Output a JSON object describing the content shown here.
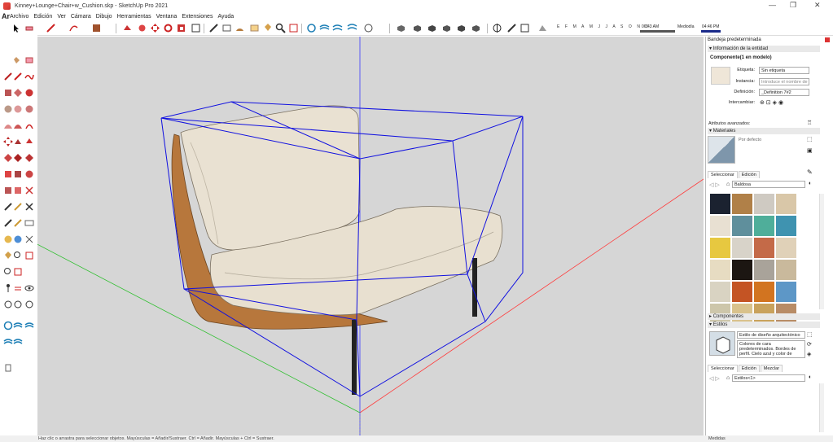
{
  "window": {
    "title": "Kinney+Lounge+Chair+w_Cushion.skp - SketchUp Pro 2021",
    "minimize_glyph": "—",
    "maximize_glyph": "❐",
    "close_glyph": "✕"
  },
  "menubar": {
    "prefix": "Ar",
    "items": [
      "Archivo",
      "Edición",
      "Ver",
      "Cámara",
      "Dibujo",
      "Herramientas",
      "Ventana",
      "Extensiones",
      "Ayuda"
    ]
  },
  "sun": {
    "months": "E F M A M J J A S O N D",
    "time_start": "06:43 AM",
    "label": "Mediodía",
    "time_end": "04:46 PM"
  },
  "tray": {
    "title": "Bandeja predeterminada",
    "entity_info": {
      "header": "Información de la entidad",
      "kind": "Componente(1 en modelo)",
      "tag_label": "Etiqueta:",
      "tag_value": "Sin etiqueta",
      "instance_label": "Instancia:",
      "instance_placeholder": "Introduce el nombre de",
      "definition_label": "Definición:",
      "definition_value": "_Definition 7#2",
      "toggles_label": "Intercambiar:",
      "advanced_label": "Atributos avanzados:"
    },
    "materials": {
      "header": "Materiales",
      "default_name": "Por defecto",
      "tabs": [
        "Seleccionar",
        "Edición"
      ],
      "library": "Baldosa",
      "swatches": [
        "#1b2230",
        "#b08048",
        "#cfcac2",
        "#d9c7a8",
        "#e8e0d2",
        "#5f8f9c",
        "#4fae9a",
        "#3f93b0",
        "#e7c840",
        "#d8d3c9",
        "#c46a48",
        "#e0d1b8",
        "#e7dcc2",
        "#1c1612",
        "#a9a39a",
        "#c9b99c",
        "#d9d3c2",
        "#c45424",
        "#d27420",
        "#5d97c7",
        "#cdc6aa",
        "#d9c28c",
        "#c9a25c",
        "#b88c66"
      ]
    },
    "components": {
      "header": "Componentes"
    },
    "styles": {
      "header": "Estilos",
      "style_name": "Estilo de diseño arquitectónico",
      "style_desc": "Colores de cara predeterminados. Bordes de perfil. Cielo azul y color de",
      "tabs": [
        "Seleccionar",
        "Edición",
        "Mezclar"
      ],
      "library": "Estilos<1>"
    }
  },
  "status": {
    "message": "Haz clic o arrastra para seleccionar objetos. Mayúsculas = Añadir/Sustraer. Ctrl = Añadir. Mayúsculas + Ctrl = Sustraer.",
    "measure_label": "Medidas"
  },
  "colors": {
    "axis_red": "#ff3a3a",
    "axis_green": "#2fbf2f",
    "axis_blue": "#3a3aff",
    "selection": "#1010e0",
    "cushion": "#e8e0d0",
    "wood": "#b7773c",
    "viewport_bg": "#d6d6d6"
  }
}
